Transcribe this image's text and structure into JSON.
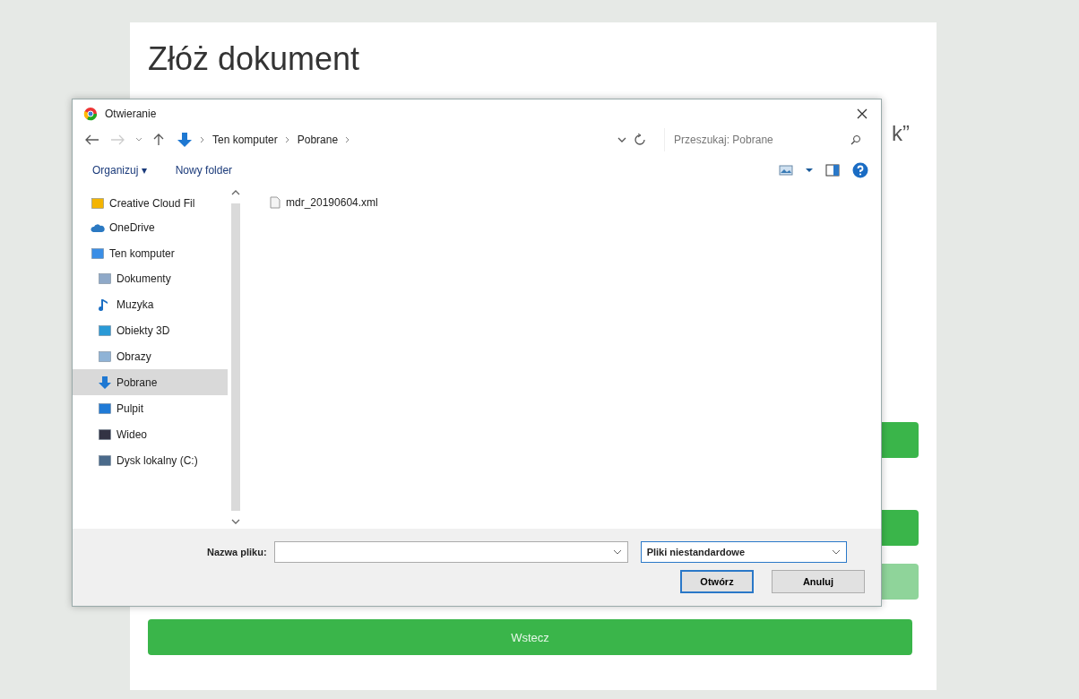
{
  "page": {
    "title": "Złóż dokument",
    "hidden_text": "k”",
    "buttons": [
      {
        "kind": "solid"
      },
      {
        "kind": "solid"
      },
      {
        "kind": "light"
      }
    ],
    "back_button": "Wstecz"
  },
  "dialog": {
    "title": "Otwieranie",
    "path": [
      "Ten komputer",
      "Pobrane"
    ],
    "search": {
      "placeholder": "Przeszukaj: Pobrane"
    },
    "toolbar": {
      "organize": "Organizuj ▾",
      "new_folder": "Nowy folder"
    },
    "sidebar": {
      "items": [
        {
          "label": "Creative Cloud Fil",
          "kind": "cc",
          "selected": false
        },
        {
          "label": "OneDrive",
          "kind": "cloud",
          "selected": false
        },
        {
          "label": "Ten komputer",
          "kind": "pc",
          "selected": false,
          "children": [
            {
              "label": "Dokumenty",
              "kind": "doc",
              "selected": false
            },
            {
              "label": "Muzyka",
              "kind": "music",
              "selected": false
            },
            {
              "label": "Obiekty 3D",
              "kind": "cube",
              "selected": false
            },
            {
              "label": "Obrazy",
              "kind": "image",
              "selected": false
            },
            {
              "label": "Pobrane",
              "kind": "download",
              "selected": true
            },
            {
              "label": "Pulpit",
              "kind": "desktop",
              "selected": false
            },
            {
              "label": "Wideo",
              "kind": "video",
              "selected": false
            },
            {
              "label": "Dysk lokalny (C:)",
              "kind": "drive",
              "selected": false
            }
          ]
        }
      ]
    },
    "files": [
      {
        "name": "mdr_20190604.xml"
      }
    ],
    "filename_label": "Nazwa pliku:",
    "filter": "Pliki niestandardowe",
    "open_button": "Otwórz",
    "cancel_button": "Anuluj"
  }
}
